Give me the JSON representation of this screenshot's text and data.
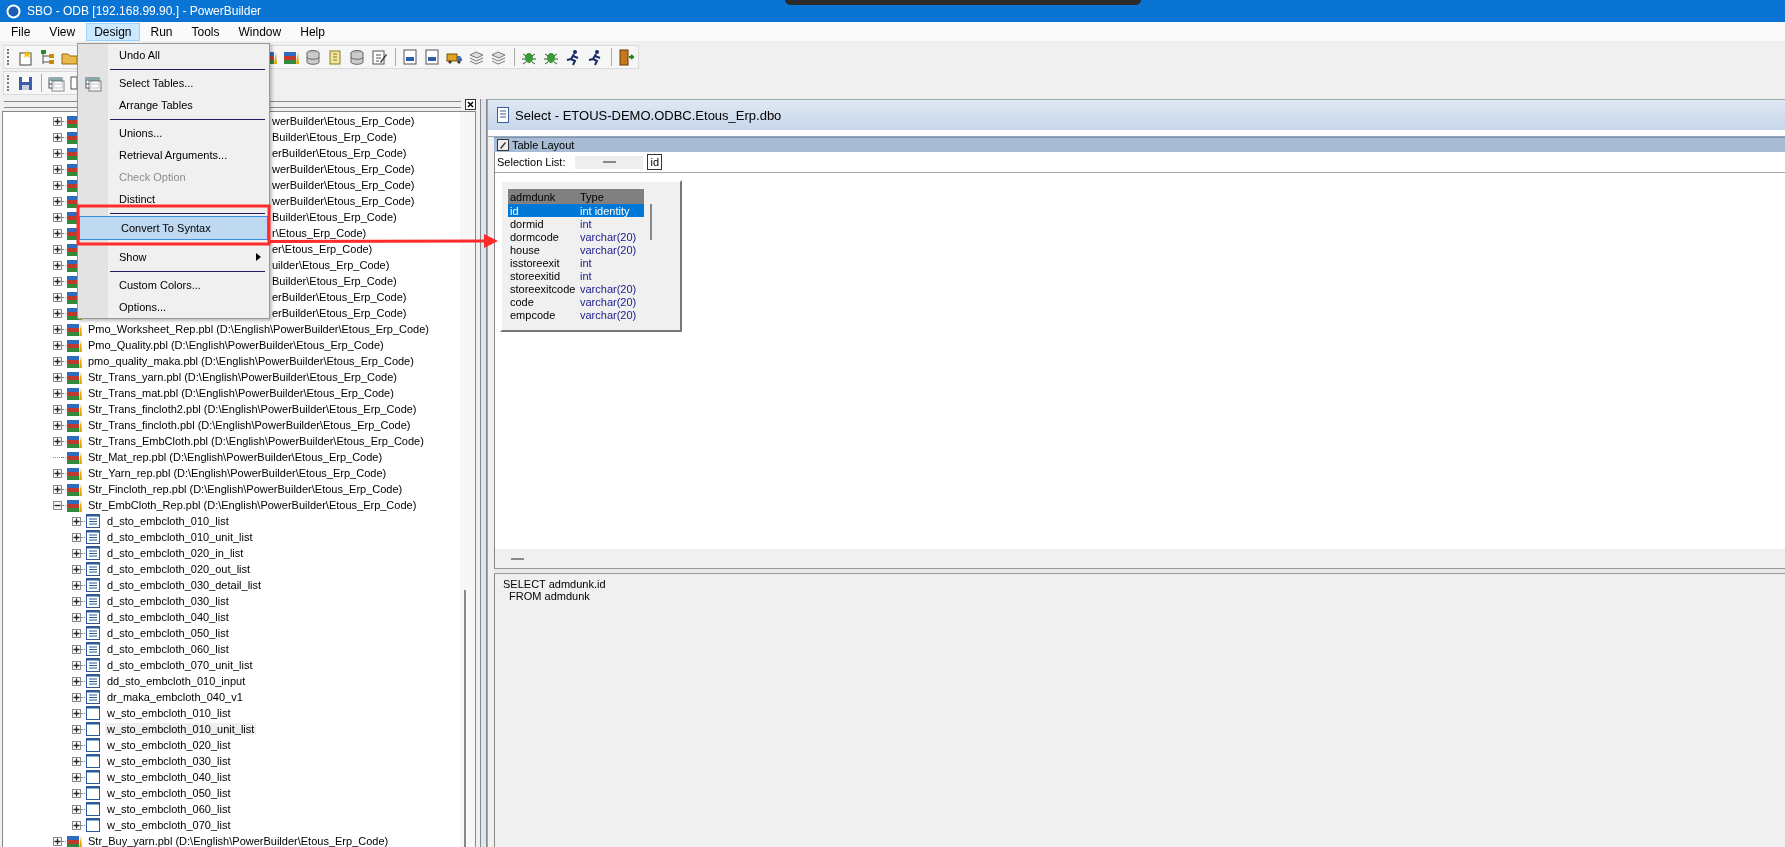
{
  "window": {
    "title": "SBO - ODB [192.168.99.90.]  - PowerBuilder"
  },
  "menu_bar": [
    {
      "label": "File",
      "selected": false
    },
    {
      "label": "View",
      "selected": false
    },
    {
      "label": "Design",
      "selected": true
    },
    {
      "label": "Run",
      "selected": false
    },
    {
      "label": "Tools",
      "selected": false
    },
    {
      "label": "Window",
      "selected": false
    },
    {
      "label": "Help",
      "selected": false
    }
  ],
  "design_menu": [
    {
      "kind": "item",
      "label": "Undo All",
      "disabled": false,
      "selected": false,
      "submenu": false
    },
    {
      "kind": "separator"
    },
    {
      "kind": "item",
      "label": "Select Tables...",
      "disabled": false,
      "selected": false,
      "submenu": false
    },
    {
      "kind": "item",
      "label": "Arrange Tables",
      "disabled": false,
      "selected": false,
      "submenu": false
    },
    {
      "kind": "separator"
    },
    {
      "kind": "item",
      "label": "Unions...",
      "disabled": false,
      "selected": false,
      "submenu": false
    },
    {
      "kind": "item",
      "label": "Retrieval Arguments...",
      "disabled": false,
      "selected": false,
      "submenu": false
    },
    {
      "kind": "item",
      "label": "Check Option",
      "disabled": true,
      "selected": false,
      "submenu": false
    },
    {
      "kind": "item",
      "label": "Distinct",
      "disabled": false,
      "selected": false,
      "submenu": false
    },
    {
      "kind": "separator"
    },
    {
      "kind": "item",
      "label": "Convert To Syntax",
      "disabled": false,
      "selected": true,
      "submenu": false
    },
    {
      "kind": "separator"
    },
    {
      "kind": "item",
      "label": "Show",
      "disabled": false,
      "selected": false,
      "submenu": true
    },
    {
      "kind": "separator"
    },
    {
      "kind": "item",
      "label": "Custom Colors...",
      "disabled": false,
      "selected": false,
      "submenu": false
    },
    {
      "kind": "item",
      "label": "Options...",
      "disabled": false,
      "selected": false,
      "submenu": false
    }
  ],
  "library_tree": [
    {
      "kind": "library",
      "label": "werBuilder\\Etous_Erp_Code)",
      "covered": true,
      "expanded": false,
      "leaf": false,
      "selected": false
    },
    {
      "kind": "library",
      "label": "Builder\\Etous_Erp_Code)",
      "covered": true,
      "expanded": false,
      "leaf": false,
      "selected": false
    },
    {
      "kind": "library",
      "label": "erBuilder\\Etous_Erp_Code)",
      "covered": true,
      "expanded": false,
      "leaf": false,
      "selected": false
    },
    {
      "kind": "library",
      "label": "werBuilder\\Etous_Erp_Code)",
      "covered": true,
      "expanded": false,
      "leaf": false,
      "selected": false
    },
    {
      "kind": "library",
      "label": "werBuilder\\Etous_Erp_Code)",
      "covered": true,
      "expanded": false,
      "leaf": false,
      "selected": false
    },
    {
      "kind": "library",
      "label": "werBuilder\\Etous_Erp_Code)",
      "covered": true,
      "expanded": false,
      "leaf": false,
      "selected": false
    },
    {
      "kind": "library",
      "label": "Builder\\Etous_Erp_Code)",
      "covered": true,
      "expanded": false,
      "leaf": false,
      "selected": false
    },
    {
      "kind": "library",
      "label": "r\\Etous_Erp_Code)",
      "covered": true,
      "expanded": false,
      "leaf": false,
      "selected": false
    },
    {
      "kind": "library",
      "label": "er\\Etous_Erp_Code)",
      "covered": true,
      "expanded": false,
      "leaf": false,
      "selected": false
    },
    {
      "kind": "library",
      "label": "uilder\\Etous_Erp_Code)",
      "covered": true,
      "expanded": false,
      "leaf": false,
      "selected": false
    },
    {
      "kind": "library",
      "label": "Builder\\Etous_Erp_Code)",
      "covered": true,
      "expanded": false,
      "leaf": false,
      "selected": false
    },
    {
      "kind": "library",
      "label": "erBuilder\\Etous_Erp_Code)",
      "covered": true,
      "expanded": false,
      "leaf": false,
      "selected": false
    },
    {
      "kind": "library",
      "label": "erBuilder\\Etous_Erp_Code)",
      "covered": true,
      "expanded": false,
      "leaf": false,
      "selected": false
    },
    {
      "kind": "library",
      "label": "Pmo_Worksheet_Rep.pbl (D:\\English\\PowerBuilder\\Etous_Erp_Code)",
      "covered": false,
      "expanded": false,
      "leaf": false,
      "selected": false
    },
    {
      "kind": "library",
      "label": "Pmo_Quality.pbl (D:\\English\\PowerBuilder\\Etous_Erp_Code)",
      "covered": false,
      "expanded": false,
      "leaf": false,
      "selected": false
    },
    {
      "kind": "library",
      "label": "pmo_quality_maka.pbl (D:\\English\\PowerBuilder\\Etous_Erp_Code)",
      "covered": false,
      "expanded": false,
      "leaf": false,
      "selected": false
    },
    {
      "kind": "library",
      "label": "Str_Trans_yarn.pbl (D:\\English\\PowerBuilder\\Etous_Erp_Code)",
      "covered": false,
      "expanded": false,
      "leaf": false,
      "selected": false
    },
    {
      "kind": "library",
      "label": "Str_Trans_mat.pbl (D:\\English\\PowerBuilder\\Etous_Erp_Code)",
      "covered": false,
      "expanded": false,
      "leaf": false,
      "selected": false
    },
    {
      "kind": "library",
      "label": "Str_Trans_fincloth2.pbl (D:\\English\\PowerBuilder\\Etous_Erp_Code)",
      "covered": false,
      "expanded": false,
      "leaf": false,
      "selected": false
    },
    {
      "kind": "library",
      "label": "Str_Trans_fincloth.pbl (D:\\English\\PowerBuilder\\Etous_Erp_Code)",
      "covered": false,
      "expanded": false,
      "leaf": false,
      "selected": false
    },
    {
      "kind": "library",
      "label": "Str_Trans_EmbCloth.pbl (D:\\English\\PowerBuilder\\Etous_Erp_Code)",
      "covered": false,
      "expanded": false,
      "leaf": false,
      "selected": false
    },
    {
      "kind": "library",
      "label": "Str_Mat_rep.pbl (D:\\English\\PowerBuilder\\Etous_Erp_Code)",
      "covered": false,
      "leaf": true,
      "selected": false
    },
    {
      "kind": "library",
      "label": "Str_Yarn_rep.pbl (D:\\English\\PowerBuilder\\Etous_Erp_Code)",
      "covered": false,
      "expanded": false,
      "leaf": false,
      "selected": false
    },
    {
      "kind": "library",
      "label": "Str_Fincloth_rep.pbl (D:\\English\\PowerBuilder\\Etous_Erp_Code)",
      "covered": false,
      "expanded": false,
      "leaf": false,
      "selected": false
    },
    {
      "kind": "library",
      "label": "Str_EmbCloth_Rep.pbl (D:\\English\\PowerBuilder\\Etous_Erp_Code)",
      "covered": false,
      "expanded": true,
      "leaf": false,
      "selected": false,
      "children": [
        {
          "kind": "datawindow",
          "label": "d_sto_embcloth_010_list",
          "covered": false,
          "expanded": false,
          "leaf": false,
          "selected": false
        },
        {
          "kind": "datawindow",
          "label": "d_sto_embcloth_010_unit_list",
          "covered": false,
          "expanded": false,
          "leaf": false,
          "selected": false
        },
        {
          "kind": "datawindow",
          "label": "d_sto_embcloth_020_in_list",
          "covered": false,
          "expanded": false,
          "leaf": false,
          "selected": false
        },
        {
          "kind": "datawindow",
          "label": "d_sto_embcloth_020_out_list",
          "covered": false,
          "expanded": false,
          "leaf": false,
          "selected": false
        },
        {
          "kind": "datawindow",
          "label": "d_sto_embcloth_030_detail_list",
          "covered": false,
          "expanded": false,
          "leaf": false,
          "selected": false
        },
        {
          "kind": "datawindow",
          "label": "d_sto_embcloth_030_list",
          "covered": false,
          "expanded": false,
          "leaf": false,
          "selected": false
        },
        {
          "kind": "datawindow",
          "label": "d_sto_embcloth_040_list",
          "covered": false,
          "expanded": false,
          "leaf": false,
          "selected": false
        },
        {
          "kind": "datawindow",
          "label": "d_sto_embcloth_050_list",
          "covered": false,
          "expanded": false,
          "leaf": false,
          "selected": false
        },
        {
          "kind": "datawindow",
          "label": "d_sto_embcloth_060_list",
          "covered": false,
          "expanded": false,
          "leaf": false,
          "selected": false
        },
        {
          "kind": "datawindow",
          "label": "d_sto_embcloth_070_unit_list",
          "covered": false,
          "expanded": false,
          "leaf": false,
          "selected": false
        },
        {
          "kind": "datawindow",
          "label": "dd_sto_embcloth_010_input",
          "covered": false,
          "expanded": false,
          "leaf": false,
          "selected": false
        },
        {
          "kind": "datawindow",
          "label": "dr_maka_embcloth_040_v1",
          "covered": false,
          "expanded": false,
          "leaf": false,
          "selected": false
        },
        {
          "kind": "window",
          "label": "w_sto_embcloth_010_list",
          "covered": false,
          "expanded": false,
          "leaf": false,
          "selected": false
        },
        {
          "kind": "window",
          "label": "w_sto_embcloth_010_unit_list",
          "covered": false,
          "expanded": false,
          "leaf": false,
          "selected": true
        },
        {
          "kind": "window",
          "label": "w_sto_embcloth_020_list",
          "covered": false,
          "expanded": false,
          "leaf": false,
          "selected": false
        },
        {
          "kind": "window",
          "label": "w_sto_embcloth_030_list",
          "covered": false,
          "expanded": false,
          "leaf": false,
          "selected": false
        },
        {
          "kind": "window",
          "label": "w_sto_embcloth_040_list",
          "covered": false,
          "expanded": false,
          "leaf": false,
          "selected": false
        },
        {
          "kind": "window",
          "label": "w_sto_embcloth_050_list",
          "covered": false,
          "expanded": false,
          "leaf": false,
          "selected": false
        },
        {
          "kind": "window",
          "label": "w_sto_embcloth_060_list",
          "covered": false,
          "expanded": false,
          "leaf": false,
          "selected": false
        },
        {
          "kind": "window",
          "label": "w_sto_embcloth_070_list",
          "covered": false,
          "expanded": false,
          "leaf": false,
          "selected": false
        }
      ]
    },
    {
      "kind": "library",
      "label": "Str_Buy_yarn.pbl (D:\\English\\PowerBuilder\\Etous_Erp_Code)",
      "covered": false,
      "expanded": false,
      "leaf": false,
      "selected": false
    }
  ],
  "select_window": {
    "title": "Select - ETOUS-DEMO.ODBC.Etous_Erp.dbo",
    "pane_title": "Table Layout",
    "selection_list": {
      "label": "Selection List:",
      "value": "id"
    },
    "table": {
      "columns": [
        "admdunk",
        "Type"
      ],
      "rows": [
        {
          "name": "id",
          "type": "int identity",
          "selected": true
        },
        {
          "name": "dormid",
          "type": "int",
          "selected": false
        },
        {
          "name": "dormcode",
          "type": "varchar(20)",
          "selected": false
        },
        {
          "name": "house",
          "type": "varchar(20)",
          "selected": false
        },
        {
          "name": "isstoreexit",
          "type": "int",
          "selected": false
        },
        {
          "name": "storeexitid",
          "type": "int",
          "selected": false
        },
        {
          "name": "storeexitcode",
          "type": "varchar(20)",
          "selected": false
        },
        {
          "name": "code",
          "type": "varchar(20)",
          "selected": false
        },
        {
          "name": "empcode",
          "type": "varchar(20)",
          "selected": false
        }
      ]
    },
    "sql": [
      "SELECT admdunk.id",
      "  FROM admdunk"
    ]
  }
}
